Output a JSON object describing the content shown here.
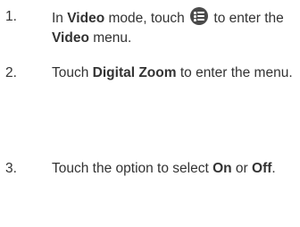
{
  "steps": [
    {
      "number": "1.",
      "parts": [
        "In ",
        "Video",
        " mode, touch ",
        " to enter the ",
        "Video",
        " menu."
      ],
      "icon": "menu-list-icon"
    },
    {
      "number": "2.",
      "parts": [
        "Touch ",
        "Digital Zoom",
        " to enter the menu."
      ]
    },
    {
      "number": "3.",
      "parts": [
        "Touch the option to select ",
        "On",
        " or ",
        "Off",
        "."
      ]
    }
  ]
}
